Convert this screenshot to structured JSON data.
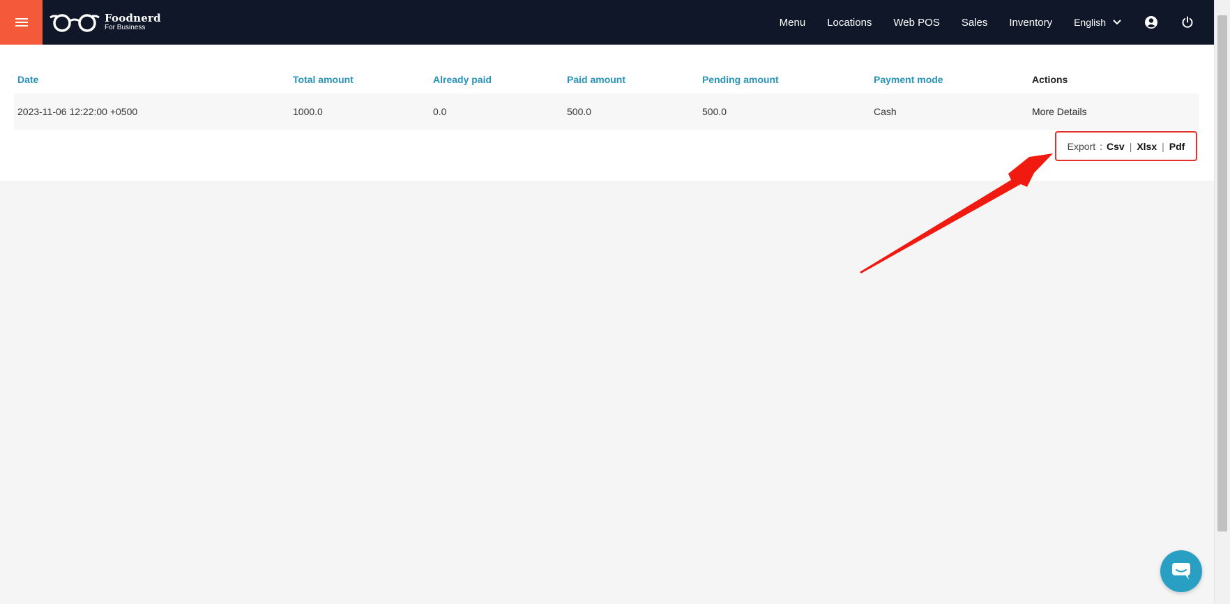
{
  "brand": {
    "name": "Foodnerd",
    "subtitle": "For Business"
  },
  "nav": {
    "links": [
      "Menu",
      "Locations",
      "Web POS",
      "Sales",
      "Inventory"
    ],
    "language": "English"
  },
  "table": {
    "headers": [
      "Date",
      "Total amount",
      "Already paid",
      "Paid amount",
      "Pending amount",
      "Payment mode",
      "Actions"
    ],
    "rows": [
      [
        "2023-11-06 12:22:00 +0500",
        "1000.0",
        "0.0",
        "500.0",
        "500.0",
        "Cash",
        "More Details"
      ]
    ]
  },
  "export": {
    "label": "Export",
    "options": [
      "Csv",
      "Xlsx",
      "Pdf"
    ]
  },
  "colors": {
    "navbar": "#0f1729",
    "menu_toggle": "#f4593a",
    "header_text": "#2a93b7",
    "highlight": "#e8302a",
    "chat": "#2a9fc4"
  }
}
